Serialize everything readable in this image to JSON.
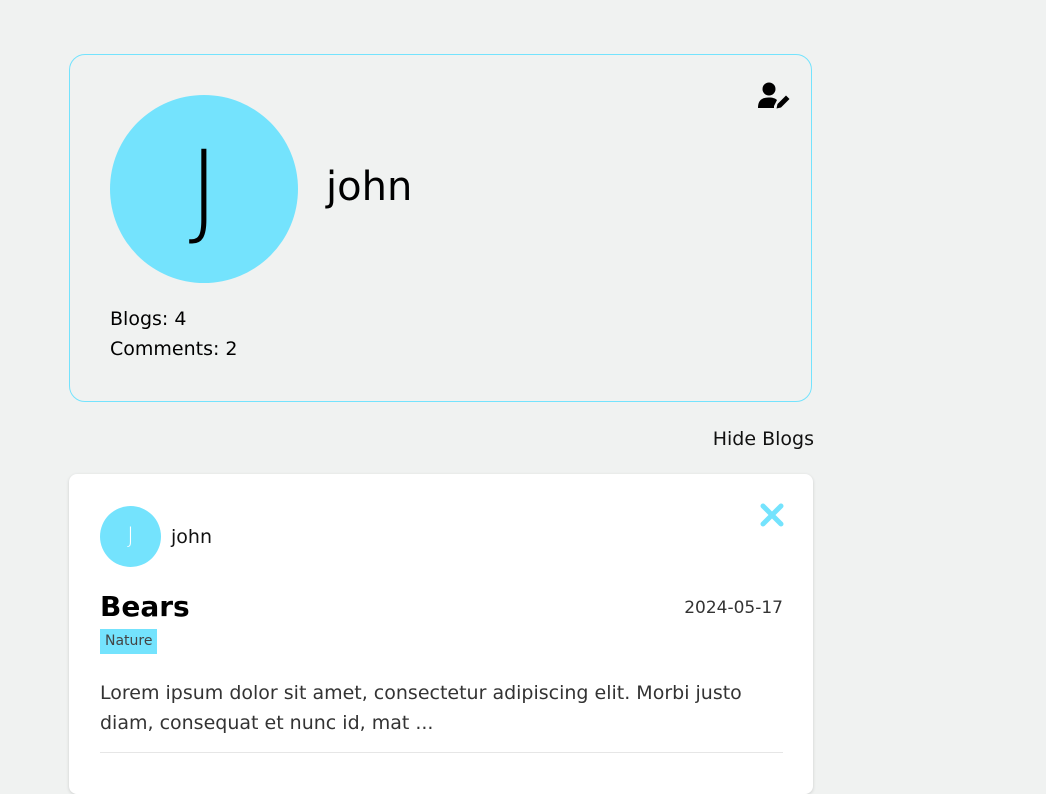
{
  "profile": {
    "avatar_letter": "J",
    "name": "john",
    "blogs_label": "Blogs:",
    "blogs_count": "4",
    "comments_label": "Comments:",
    "comments_count": "2",
    "edit_icon": "user-edit-icon"
  },
  "toggle": {
    "label": "Hide Blogs"
  },
  "blogs": [
    {
      "author_letter": "J",
      "author": "john",
      "title": "Bears",
      "date": "2024-05-17",
      "tag": "Nature",
      "excerpt": "Lorem ipsum dolor sit amet, consectetur adipiscing elit. Morbi justo diam, consequat et nunc id, mat ...",
      "delete_icon": "close-icon"
    }
  ],
  "colors": {
    "accent": "#74e3fd",
    "background": "#f0f2f1",
    "card": "#ffffff"
  }
}
